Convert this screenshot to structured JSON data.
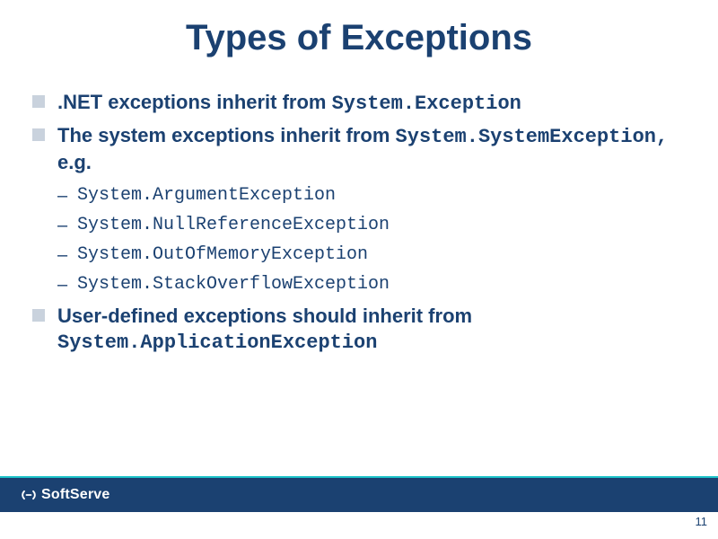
{
  "title": "Types of Exceptions",
  "bullets": [
    {
      "pre": ".NET exceptions inherit from ",
      "mono": "System.Exception",
      "post": "",
      "sub": []
    },
    {
      "pre": "The system exceptions inherit from ",
      "mono": "System.SystemException,",
      "post": " e.g.",
      "sub": [
        "System.ArgumentException",
        "System.NullReferenceException",
        "System.OutOfMemoryException",
        "System.StackOverflowException"
      ]
    },
    {
      "pre": "User-defined exceptions should inherit from ",
      "mono": "System.ApplicationException",
      "post": "",
      "sub": []
    }
  ],
  "footer": {
    "brand": "SoftServe",
    "page_number": "11"
  }
}
